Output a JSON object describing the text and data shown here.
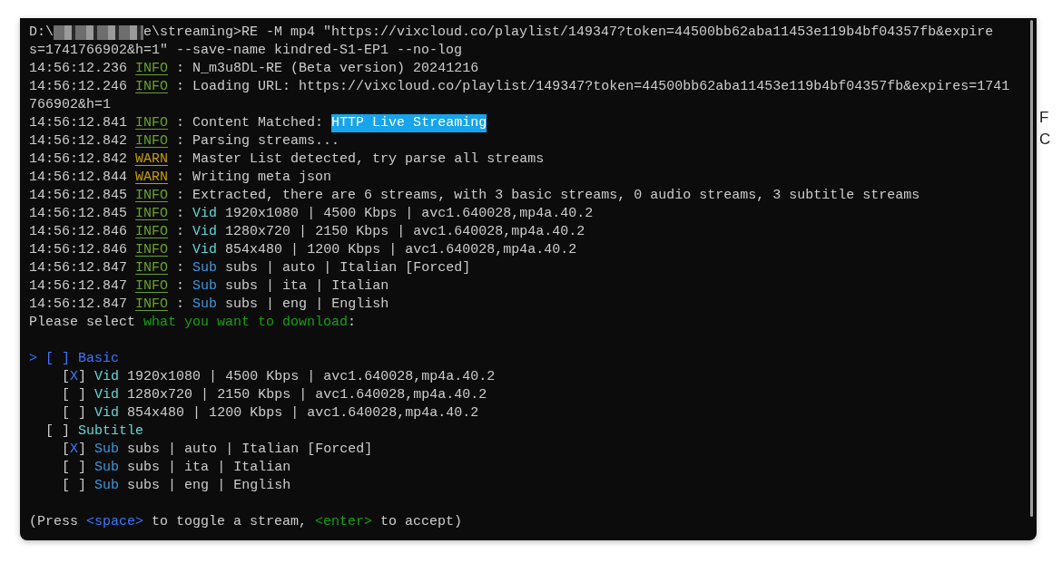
{
  "terminal": {
    "lines": [
      {
        "kind": "prompt",
        "segments": [
          {
            "kind": "plain",
            "text": "D:\\"
          },
          {
            "kind": "redacted"
          },
          {
            "kind": "plain",
            "text": "e\\streaming>RE -M mp4 \"https://vixcloud.co/playlist/149347?token=44500bb62aba11453e119b4bf04357fb&expire"
          }
        ]
      },
      {
        "kind": "text",
        "segments": [
          {
            "kind": "plain",
            "text": "s=1741766902&h=1\" --save-name kindred-S1-EP1 --no-log"
          }
        ]
      },
      {
        "kind": "log",
        "time": "14:56:12.236",
        "level": "INFO",
        "segments": [
          {
            "kind": "plain",
            "text": ": N_m3u8DL-RE (Beta version) 20241216"
          }
        ]
      },
      {
        "kind": "log",
        "time": "14:56:12.246",
        "level": "INFO",
        "segments": [
          {
            "kind": "plain",
            "text": ": Loading URL: https://vixcloud.co/playlist/149347?token=44500bb62aba11453e119b4bf04357fb&expires=1741"
          }
        ]
      },
      {
        "kind": "text",
        "segments": [
          {
            "kind": "plain",
            "text": "766902&h=1"
          }
        ]
      },
      {
        "kind": "log",
        "time": "14:56:12.841",
        "level": "INFO",
        "segments": [
          {
            "kind": "plain",
            "text": ": Content Matched: "
          },
          {
            "kind": "highlight",
            "text": "HTTP Live Streaming"
          }
        ]
      },
      {
        "kind": "log",
        "time": "14:56:12.842",
        "level": "INFO",
        "segments": [
          {
            "kind": "plain",
            "text": ": Parsing streams..."
          }
        ]
      },
      {
        "kind": "log",
        "time": "14:56:12.842",
        "level": "WARN",
        "segments": [
          {
            "kind": "plain",
            "text": ": Master List detected, try parse all streams"
          }
        ]
      },
      {
        "kind": "log",
        "time": "14:56:12.844",
        "level": "WARN",
        "segments": [
          {
            "kind": "plain",
            "text": ": Writing meta json"
          }
        ]
      },
      {
        "kind": "log",
        "time": "14:56:12.845",
        "level": "INFO",
        "segments": [
          {
            "kind": "plain",
            "text": ": Extracted, there are 6 streams, with 3 basic streams, 0 audio streams, 3 subtitle streams"
          }
        ]
      },
      {
        "kind": "log",
        "time": "14:56:12.845",
        "level": "INFO",
        "segments": [
          {
            "kind": "plain",
            "text": ": "
          },
          {
            "kind": "vid",
            "text": "Vid"
          },
          {
            "kind": "plain",
            "text": " 1920x1080 | 4500 Kbps | avc1.640028,mp4a.40.2"
          }
        ]
      },
      {
        "kind": "log",
        "time": "14:56:12.846",
        "level": "INFO",
        "segments": [
          {
            "kind": "plain",
            "text": ": "
          },
          {
            "kind": "vid",
            "text": "Vid"
          },
          {
            "kind": "plain",
            "text": " 1280x720 | 2150 Kbps | avc1.640028,mp4a.40.2"
          }
        ]
      },
      {
        "kind": "log",
        "time": "14:56:12.846",
        "level": "INFO",
        "segments": [
          {
            "kind": "plain",
            "text": ": "
          },
          {
            "kind": "vid",
            "text": "Vid"
          },
          {
            "kind": "plain",
            "text": " 854x480 | 1200 Kbps | avc1.640028,mp4a.40.2"
          }
        ]
      },
      {
        "kind": "log",
        "time": "14:56:12.847",
        "level": "INFO",
        "segments": [
          {
            "kind": "plain",
            "text": ": "
          },
          {
            "kind": "sub",
            "text": "Sub"
          },
          {
            "kind": "plain",
            "text": " subs | auto | Italian [Forced]"
          }
        ]
      },
      {
        "kind": "log",
        "time": "14:56:12.847",
        "level": "INFO",
        "segments": [
          {
            "kind": "plain",
            "text": ": "
          },
          {
            "kind": "sub",
            "text": "Sub"
          },
          {
            "kind": "plain",
            "text": " subs | ita | Italian"
          }
        ]
      },
      {
        "kind": "log",
        "time": "14:56:12.847",
        "level": "INFO",
        "segments": [
          {
            "kind": "plain",
            "text": ": "
          },
          {
            "kind": "sub",
            "text": "Sub"
          },
          {
            "kind": "plain",
            "text": " subs | eng | English"
          }
        ]
      },
      {
        "kind": "text",
        "segments": [
          {
            "kind": "plain",
            "text": "Please select "
          },
          {
            "kind": "green",
            "text": "what you want to download"
          },
          {
            "kind": "plain",
            "text": ":"
          }
        ]
      }
    ],
    "selection": {
      "cursor": ">",
      "box_open": "[",
      "box_close": "]",
      "groups": [
        {
          "label": "Basic",
          "kind": "basic",
          "focused": true,
          "checked": false,
          "items": [
            {
              "checked": true,
              "mark": "X",
              "kind": "vid",
              "tag": "Vid",
              "text": "1920x1080 | 4500 Kbps | avc1.640028,mp4a.40.2"
            },
            {
              "checked": false,
              "kind": "vid",
              "tag": "Vid",
              "text": "1280x720 | 2150 Kbps | avc1.640028,mp4a.40.2"
            },
            {
              "checked": false,
              "kind": "vid",
              "tag": "Vid",
              "text": "854x480 | 1200 Kbps | avc1.640028,mp4a.40.2"
            }
          ]
        },
        {
          "label": "Subtitle",
          "kind": "subtitle",
          "focused": false,
          "checked": false,
          "items": [
            {
              "checked": true,
              "mark": "X",
              "kind": "sub",
              "tag": "Sub",
              "text": "subs | auto | Italian [Forced]"
            },
            {
              "checked": false,
              "kind": "sub",
              "tag": "Sub",
              "text": "subs | ita | Italian"
            },
            {
              "checked": false,
              "kind": "sub",
              "tag": "Sub",
              "text": "subs | eng | English"
            }
          ]
        }
      ]
    },
    "footer": [
      {
        "kind": "plain",
        "text": "(Press "
      },
      {
        "kind": "blue",
        "text": "<space>"
      },
      {
        "kind": "plain",
        "text": " to toggle a stream, "
      },
      {
        "kind": "green",
        "text": "<enter>"
      },
      {
        "kind": "plain",
        "text": " to accept)"
      }
    ]
  },
  "background_window": {
    "texts": [
      "F",
      "C"
    ]
  }
}
